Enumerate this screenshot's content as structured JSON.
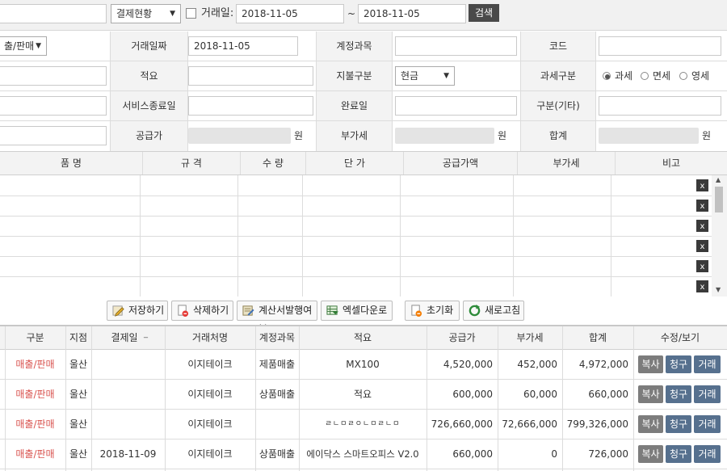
{
  "topbar": {
    "status_select": "결제현황",
    "date_checkbox_label": "거래일:",
    "date_from": "2018-11-05",
    "tilde": "~",
    "date_to": "2018-11-05",
    "search_label": "검색"
  },
  "form": {
    "type_select": "출/판매",
    "date_label": "거래일짜",
    "date_value": "2018-11-05",
    "account_label": "계정과목",
    "code_label": "코드",
    "summary_label": "적요",
    "payment_label": "지불구분",
    "payment_value": "현금",
    "tax_label": "과세구분",
    "tax_options": [
      "과세",
      "면세",
      "영세"
    ],
    "service_end_label": "서비스종료일",
    "complete_label": "완료일",
    "etc_label": "구분(기타)",
    "supply_label": "공급가",
    "won": "원",
    "vat_label": "부가세",
    "total_label": "합계"
  },
  "item_grid": {
    "headers": [
      "품 명",
      "규 격",
      "수 량",
      "단 가",
      "공급가액",
      "부가세",
      "비고"
    ],
    "delete_symbol": "x"
  },
  "toolbar": {
    "save": "저장하기",
    "delete": "삭제하기",
    "invoice": "계산서발행여부",
    "excel": "엑셀다운로드",
    "reset": "초기화",
    "refresh": "새로고침"
  },
  "list": {
    "headers": [
      "구분",
      "지점",
      "결제일",
      "거래처명",
      "계정과목",
      "적요",
      "공급가",
      "부가세",
      "합계",
      "수정/보기"
    ],
    "sort_mark": "_",
    "rows": [
      {
        "type": "매출/판매",
        "branch": "울산",
        "date": "",
        "client": "이지테이크",
        "account": "제품매출",
        "summary": "MX100",
        "supply": "4,520,000",
        "vat": "452,000",
        "total": "4,972,000"
      },
      {
        "type": "매출/판매",
        "branch": "울산",
        "date": "",
        "client": "이지테이크",
        "account": "상품매출",
        "summary": "적요",
        "supply": "600,000",
        "vat": "60,000",
        "total": "660,000"
      },
      {
        "type": "매출/판매",
        "branch": "울산",
        "date": "",
        "client": "이지테이크",
        "account": "",
        "summary": "ㄹㄴㅁㄹㅇㄴㅁㄹㄴㅁ",
        "supply": "726,660,000",
        "vat": "72,666,000",
        "total": "799,326,000"
      },
      {
        "type": "매출/판매",
        "branch": "울산",
        "date": "2018-11-09",
        "client": "이지테이크",
        "account": "상품매출",
        "summary": "에이닥스 스마트오피스 V2.0",
        "supply": "660,000",
        "vat": "0",
        "total": "726,000"
      }
    ],
    "actions": {
      "copy": "복사",
      "bill": "청구",
      "trade": "거래"
    }
  }
}
